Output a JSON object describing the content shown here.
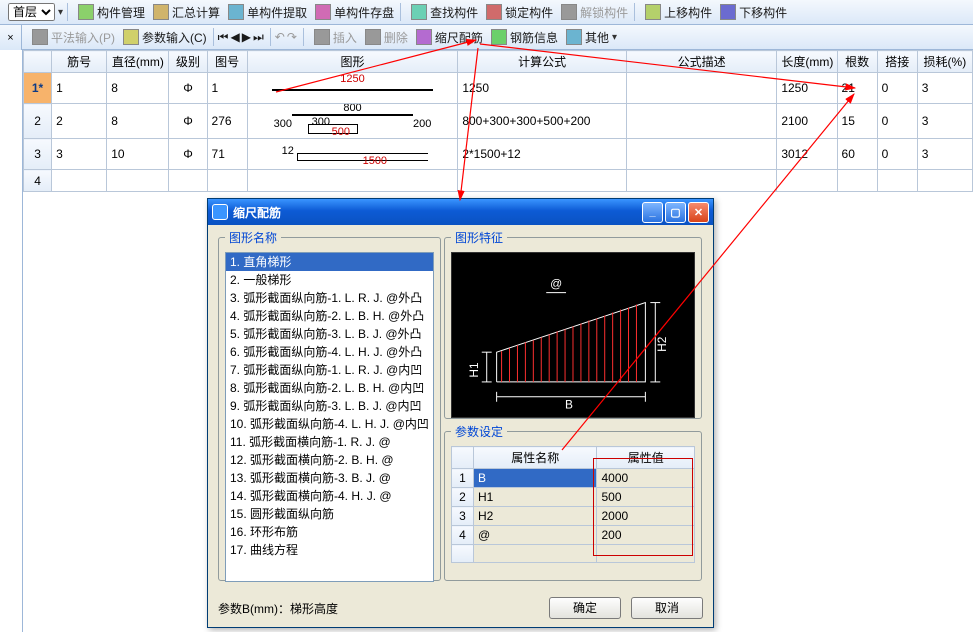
{
  "toolbar1": {
    "layer_label": "首层",
    "items": [
      {
        "label": "构件管理"
      },
      {
        "label": "汇总计算"
      },
      {
        "label": "单构件提取"
      },
      {
        "label": "单构件存盘"
      },
      {
        "label": "查找构件"
      },
      {
        "label": "锁定构件"
      },
      {
        "label": "解锁构件",
        "disabled": true
      },
      {
        "label": "上移构件"
      },
      {
        "label": "下移构件"
      }
    ]
  },
  "toolbar2": {
    "items_left": [
      {
        "label": "平法输入(P)",
        "disabled": true
      },
      {
        "label": "参数输入(C)"
      }
    ],
    "items_right": [
      {
        "label": "插入",
        "disabled": true
      },
      {
        "label": "删除",
        "disabled": true
      },
      {
        "label": "缩尺配筋"
      },
      {
        "label": "钢筋信息"
      },
      {
        "label": "其他"
      }
    ]
  },
  "grid": {
    "columns": [
      "筋号",
      "直径(mm)",
      "级别",
      "图号",
      "图形",
      "计算公式",
      "公式描述",
      "长度(mm)",
      "根数",
      "搭接",
      "损耗(%)"
    ],
    "rows": [
      {
        "rowlabel": "1*",
        "rebar_no": "1",
        "dia": "8",
        "level": "Φ",
        "shape_no": "1",
        "formula": "1250",
        "desc": "",
        "len": "1250",
        "count": "21",
        "lap": "0",
        "loss": "3",
        "shape": {
          "type": "straight",
          "top": "1250"
        }
      },
      {
        "rowlabel": "2",
        "rebar_no": "2",
        "dia": "8",
        "level": "Φ",
        "shape_no": "276",
        "formula": "800+300+300+500+200",
        "desc": "",
        "len": "2100",
        "count": "15",
        "lap": "0",
        "loss": "3",
        "shape": {
          "type": "zig",
          "top": "800",
          "l": "300",
          "m1": "300",
          "m2": "500",
          "r": "200"
        }
      },
      {
        "rowlabel": "3",
        "rebar_no": "3",
        "dia": "10",
        "level": "Φ",
        "shape_no": "71",
        "formula": "2*1500+12",
        "desc": "",
        "len": "3012",
        "count": "60",
        "lap": "0",
        "loss": "3",
        "shape": {
          "type": "hook",
          "l": "12",
          "r": "1500"
        }
      },
      {
        "rowlabel": "4",
        "rebar_no": "",
        "dia": "",
        "level": "",
        "shape_no": "",
        "formula": "",
        "desc": "",
        "len": "",
        "count": "",
        "lap": "",
        "loss": "",
        "shape": {
          "type": "none"
        }
      }
    ]
  },
  "dialog": {
    "title": "缩尺配筋",
    "group_names": "图形名称",
    "names": [
      "1. 直角梯形",
      "2. 一般梯形",
      "3. 弧形截面纵向筋-1. L. R. J. @外凸",
      "4. 弧形截面纵向筋-2. L. B. H. @外凸",
      "5. 弧形截面纵向筋-3. L. B. J. @外凸",
      "6. 弧形截面纵向筋-4. L. H. J. @外凸",
      "7. 弧形截面纵向筋-1. L. R. J. @内凹",
      "8. 弧形截面纵向筋-2. L. B. H. @内凹",
      "9. 弧形截面纵向筋-3. L. B. J. @内凹",
      "10. 弧形截面纵向筋-4. L. H. J. @内凹",
      "11. 弧形截面横向筋-1. R. J. @",
      "12. 弧形截面横向筋-2. B. H. @",
      "13. 弧形截面横向筋-3. B. J. @",
      "14. 弧形截面横向筋-4. H. J. @",
      "15. 圆形截面纵向筋",
      "16. 环形布筋",
      "17. 曲线方程"
    ],
    "group_feature": "图形特征",
    "feature_labels": {
      "B": "B",
      "H1": "H1",
      "H2": "H2",
      "at": "@"
    },
    "group_params": "参数设定",
    "prop_head_name": "属性名称",
    "prop_head_val": "属性值",
    "props": [
      {
        "name": "B",
        "val": "4000"
      },
      {
        "name": "H1",
        "val": "500"
      },
      {
        "name": "H2",
        "val": "2000"
      },
      {
        "name": "@",
        "val": "200"
      }
    ],
    "hint_label": "参数B(mm)：",
    "hint_val": "梯形高度",
    "ok": "确定",
    "cancel": "取消"
  },
  "side_x": "×"
}
